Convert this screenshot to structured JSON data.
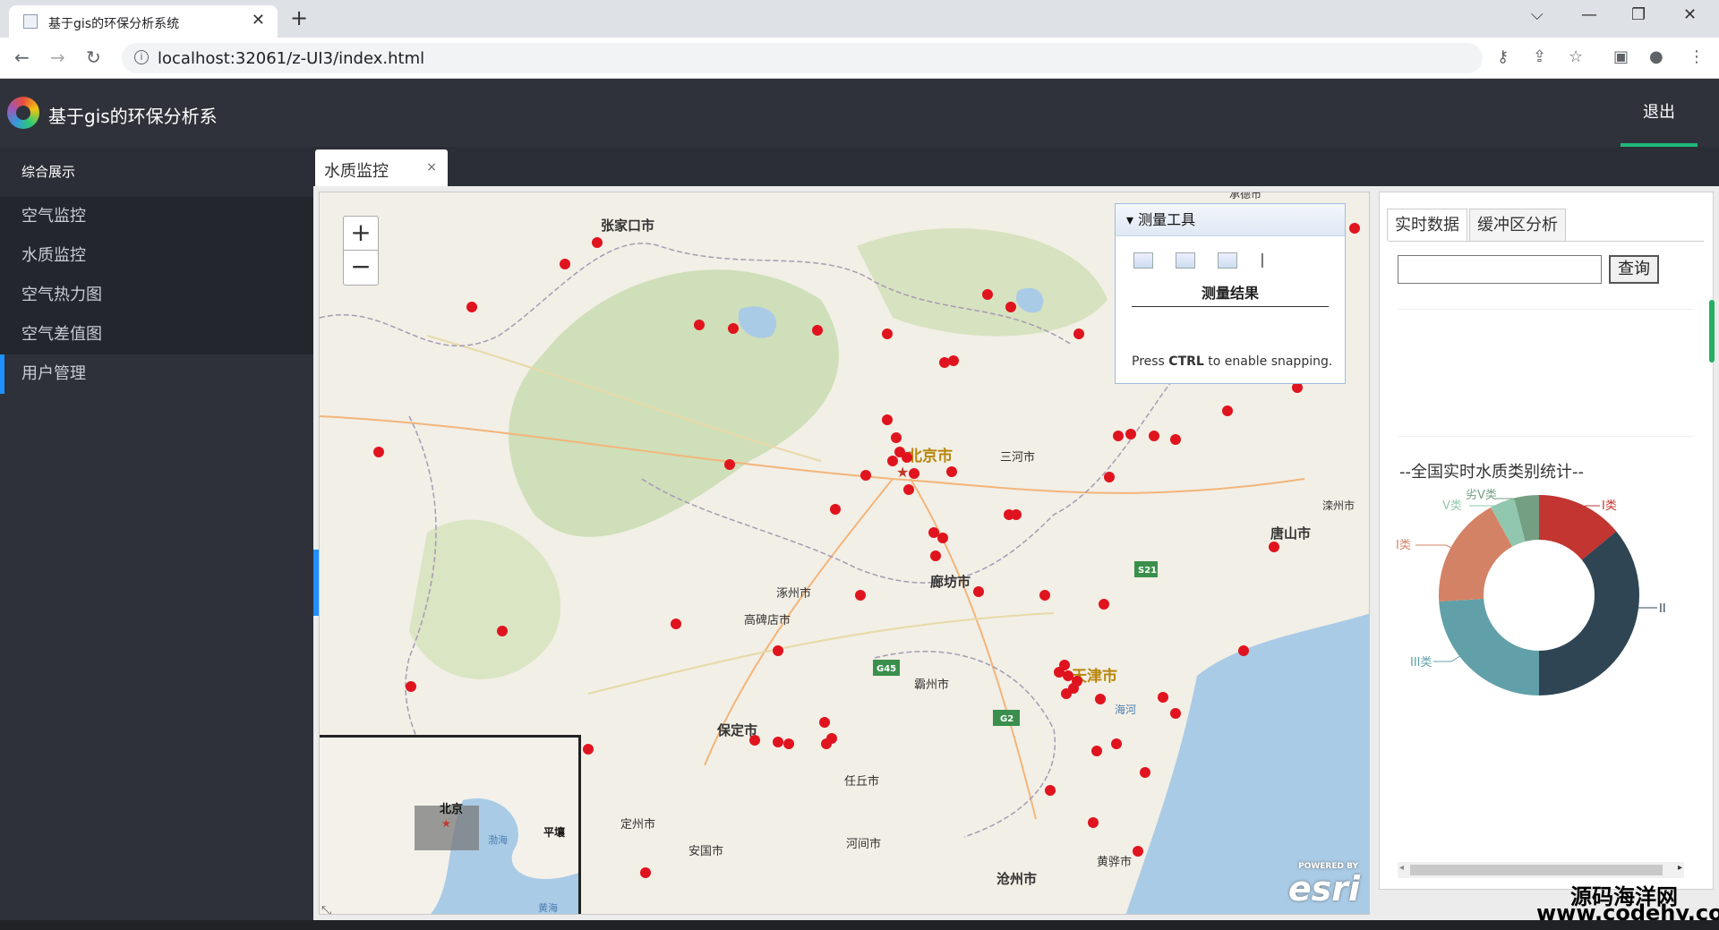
{
  "browser": {
    "tab_title": "基于gis的环保分析系统",
    "new_tab": "+",
    "url": "localhost:32061/z-UI3/index.html",
    "controls": {
      "minimize": "—",
      "maximize": "❐",
      "close": "✕",
      "dropdown": "⌵"
    }
  },
  "app": {
    "title": "基于gis的环保分析系",
    "logout_label": "退出"
  },
  "sidebar": {
    "group_label": "综合展示",
    "items": [
      {
        "label": "空气监控"
      },
      {
        "label": "水质监控"
      },
      {
        "label": "空气热力图"
      },
      {
        "label": "空气差值图"
      },
      {
        "label": "用户管理"
      }
    ]
  },
  "content_tab": {
    "label": "水质监控",
    "close": "×"
  },
  "map": {
    "zoom_in": "+",
    "zoom_out": "−",
    "city_labels": [
      "张家口市",
      "北京市",
      "三河市",
      "唐山市",
      "廊坊市",
      "涿州市",
      "高碑店市",
      "霸州市",
      "天津市",
      "保定市",
      "任丘市",
      "定州市",
      "安国市",
      "河间市",
      "沧州市",
      "黄骅市",
      "海河",
      "滦州市",
      "承德市"
    ],
    "highway_labels": [
      "S21",
      "G45",
      "G2"
    ],
    "overview_labels": [
      "北京",
      "渤海",
      "平壤",
      "黄海"
    ],
    "attribution": "esri",
    "attribution_small": "POWERED BY"
  },
  "measure_tool": {
    "title": "测量工具",
    "result_label": "测量结果",
    "snap_hint_pre": "Press ",
    "snap_hint_key": "CTRL",
    "snap_hint_post": " to enable snapping."
  },
  "right_panel": {
    "tabs": [
      "实时数据",
      "缓冲区分析"
    ],
    "query_button": "查询",
    "query_value": "",
    "stat_title": "--全国实时水质类别统计--",
    "chart_labels": {
      "c1": "I类",
      "c2": "II",
      "c3": "III类",
      "c4": "I类",
      "c5": "V类",
      "c6": "劣V类"
    }
  },
  "chart_data": {
    "type": "pie",
    "title": "--全国实时水质类别统计--",
    "categories": [
      "I类",
      "II",
      "III类",
      "I类",
      "V类",
      "劣V类"
    ],
    "values": [
      14,
      36,
      24,
      18,
      4,
      4
    ],
    "colors": [
      "#c23531",
      "#2f4554",
      "#61a0a8",
      "#d48265",
      "#91c7ae",
      "#749f83"
    ],
    "donut": true
  },
  "watermark": {
    "line1": "源码海洋网",
    "line2": "www.codehy.com"
  }
}
